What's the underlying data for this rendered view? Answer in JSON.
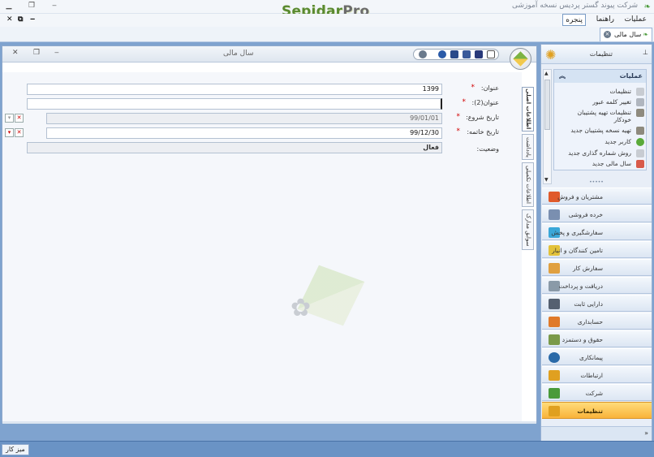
{
  "app": {
    "title": "شرکت پیوند گستر پردیس نسخه آموزشی",
    "brand_left": "Sepidar",
    "brand_right": "Pro"
  },
  "menu": {
    "items": [
      {
        "label": "عملیات"
      },
      {
        "label": "راهنما"
      },
      {
        "label": "پنجره"
      }
    ]
  },
  "doc_tab": {
    "label": "سال مالی"
  },
  "window": {
    "title": "سال مالی"
  },
  "form": {
    "title_label": "عنوان:",
    "title_value": "1399",
    "title2_label": "عنوان(2):",
    "title2_value": "",
    "start_label": "تاریخ شروع:",
    "start_value": "99/01/01",
    "end_label": "تاریخ خاتمه:",
    "end_value": "99/12/30",
    "status_label": "وضعیت:",
    "status_value": "فعال"
  },
  "side_tabs": [
    {
      "label": "اطلاعات اصلی"
    },
    {
      "label": "یادداشت"
    },
    {
      "label": "اطلاعات تکمیلی"
    },
    {
      "label": "سوابق مدارک"
    }
  ],
  "right_panel": {
    "title": "تنظیمات",
    "ops_header": "عملیات",
    "ops": [
      {
        "label": "تنظیمات"
      },
      {
        "label": "تغییر کلمه عبور"
      },
      {
        "label": "تنظیمات تهیه پشتیبان"
      },
      {
        "label": "خودکار"
      },
      {
        "label": "تهیه نسخه پشتیبان جدید"
      },
      {
        "label": "کاربر جدید"
      },
      {
        "label": "روش شماره گذاری جدید"
      },
      {
        "label": "سال مالی جدید"
      }
    ],
    "nav": [
      {
        "label": "مشتریان و فروش",
        "color": "#e05a2a"
      },
      {
        "label": "خرده فروشی",
        "color": "#7a8fb0"
      },
      {
        "label": "سفارشگیری و پخش",
        "color": "#3aa7d8"
      },
      {
        "label": "تامین کنندگان و انبار",
        "color": "#e3c23a"
      },
      {
        "label": "سفارش کار",
        "color": "#e0a040"
      },
      {
        "label": "دریافت و پرداخت",
        "color": "#8a9aa8"
      },
      {
        "label": "دارایی ثابت",
        "color": "#556070"
      },
      {
        "label": "حسابداری",
        "color": "#e07a2a"
      },
      {
        "label": "حقوق و دستمزد",
        "color": "#7a9a4a"
      },
      {
        "label": "پیمانکاری",
        "color": "#2a6aa8"
      },
      {
        "label": "ارتباطات",
        "color": "#e0a020"
      },
      {
        "label": "شرکت",
        "color": "#4a9a3a"
      },
      {
        "label": "تنظیمات",
        "color": "#e0a020"
      }
    ],
    "footer_symbol": "»"
  },
  "status": {
    "desktop_label": "میز کار"
  }
}
